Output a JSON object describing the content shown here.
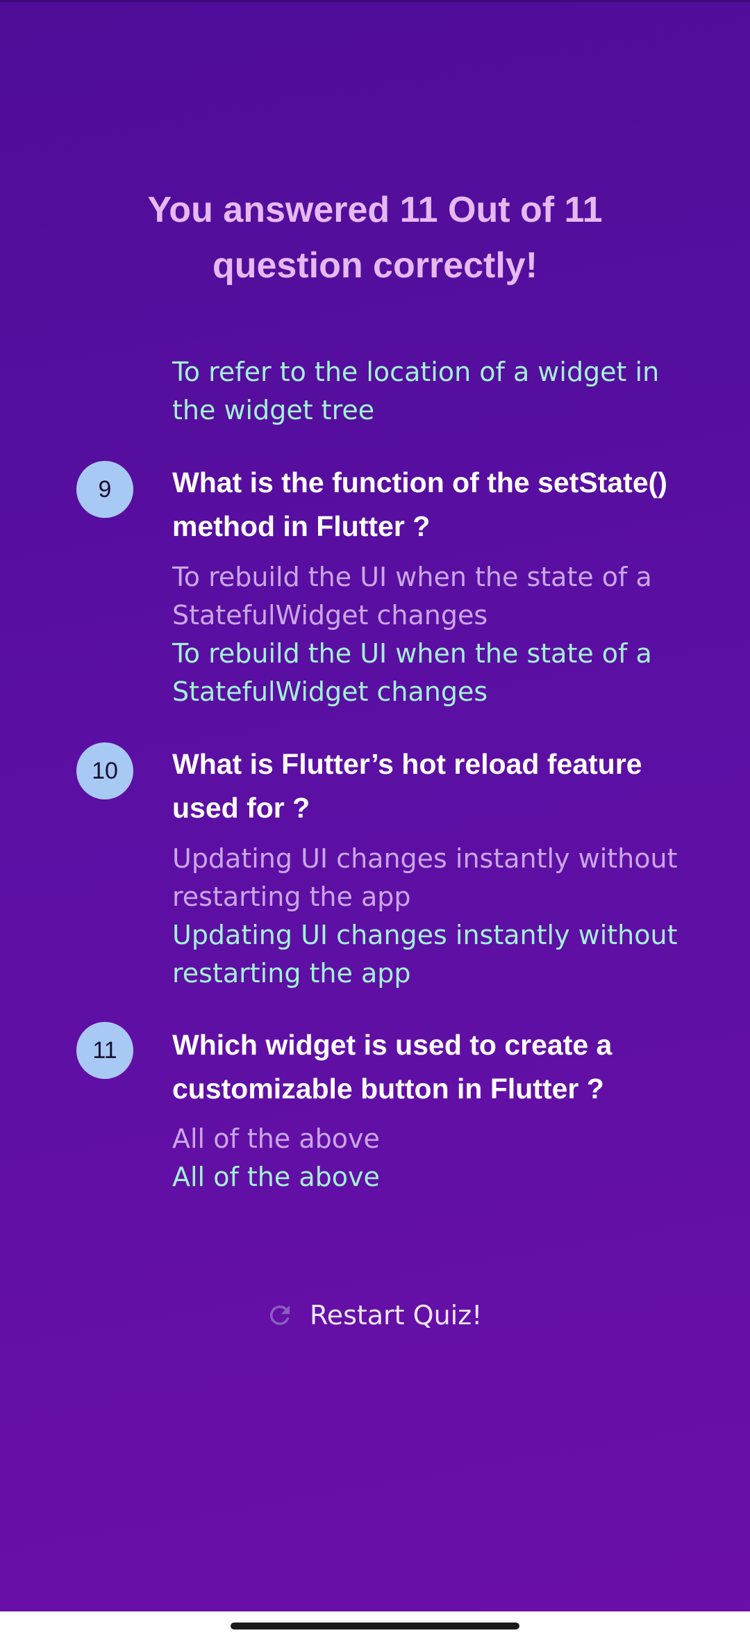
{
  "summary": {
    "title": "You answered 11 Out of 11 question correctly!"
  },
  "partial_answer": {
    "correct_answer": "To refer to the location of a widget in the widget tree"
  },
  "questions": [
    {
      "index": "9",
      "question": "What is the function of the setState() method in Flutter ?",
      "user_answer": "To rebuild the UI when the state of a StatefulWidget changes",
      "correct_answer": "To rebuild the UI when the state of a StatefulWidget changes"
    },
    {
      "index": "10",
      "question": "What is Flutter’s hot reload feature used for ?",
      "user_answer": "Updating UI changes instantly without restarting the app",
      "correct_answer": "Updating UI changes instantly without restarting the app"
    },
    {
      "index": "11",
      "question": "Which widget is used to create a customizable button in Flutter ?",
      "user_answer": "All of the above",
      "correct_answer": "All of the above"
    }
  ],
  "restart_button": {
    "label": "Restart Quiz!",
    "icon": "refresh-icon"
  },
  "colors": {
    "background_top": "#4f0d98",
    "background_bottom": "#6a0fa8",
    "title": "#e6b9f0",
    "user_answer": "#c9a6e6",
    "correct_answer": "#a3f0d9",
    "badge": "#a9c9f5"
  }
}
